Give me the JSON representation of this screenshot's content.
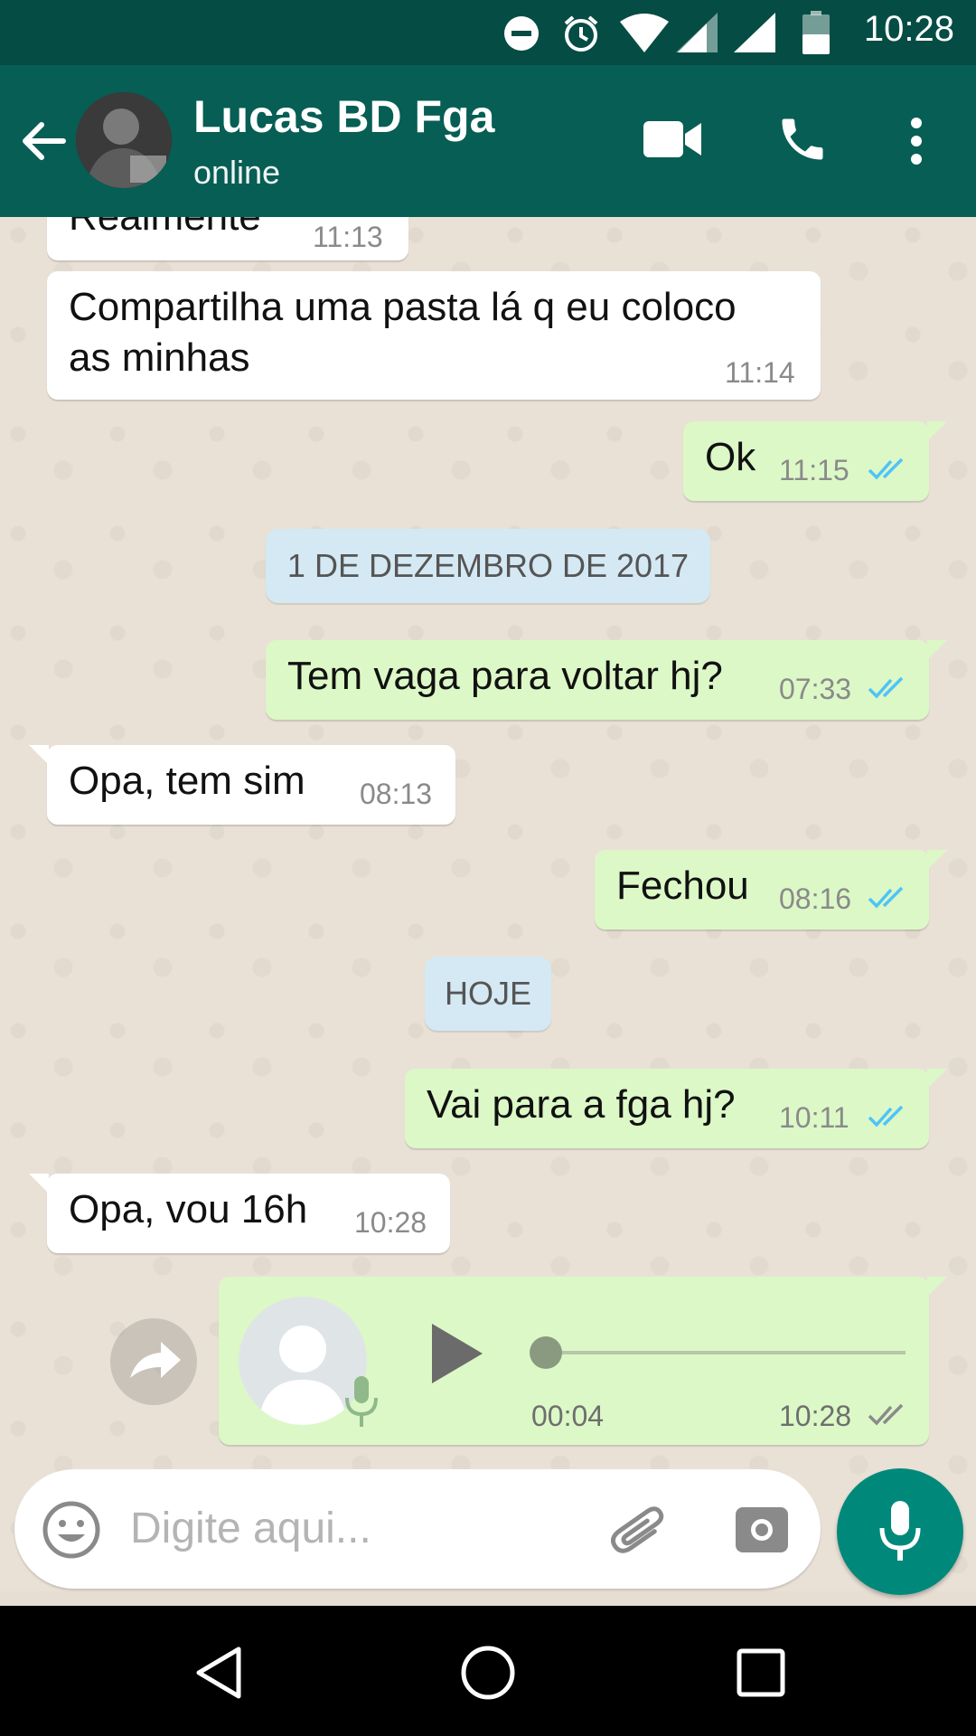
{
  "status_bar": {
    "time": "10:28",
    "icons": [
      "do-not-disturb-icon",
      "alarm-icon",
      "wifi-icon",
      "cell-signal-icon",
      "cell-signal-icon",
      "battery-icon"
    ]
  },
  "header": {
    "contact_name": "Lucas BD Fga",
    "status": "online",
    "icons": [
      "back-arrow-icon",
      "video-call-icon",
      "phone-icon",
      "more-vert-icon"
    ]
  },
  "messages": [
    {
      "direction": "in",
      "text": "Realmente",
      "time": "11:13"
    },
    {
      "direction": "in",
      "text_lines": [
        "Compartilha uma pasta lá q eu coloco",
        "as minhas"
      ],
      "time": "11:14"
    },
    {
      "direction": "out",
      "text": "Ok",
      "time": "11:15",
      "status": "read"
    },
    {
      "type": "date",
      "text": "1 DE DEZEMBRO DE 2017"
    },
    {
      "direction": "out",
      "text": "Tem vaga para voltar hj?",
      "time": "07:33",
      "status": "read"
    },
    {
      "direction": "in",
      "text": "Opa, tem sim",
      "time": "08:13"
    },
    {
      "direction": "out",
      "text": "Fechou",
      "time": "08:16",
      "status": "read"
    },
    {
      "type": "date",
      "text": "HOJE"
    },
    {
      "direction": "out",
      "text": "Vai para a fga hj?",
      "time": "10:11",
      "status": "read"
    },
    {
      "direction": "in",
      "text": "Opa, vou 16h",
      "time": "10:28"
    },
    {
      "direction": "out",
      "type": "voice",
      "duration": "00:04",
      "time": "10:28",
      "status": "delivered",
      "progress": 0
    }
  ],
  "composer": {
    "placeholder": "Digite aqui...",
    "icons": [
      "emoji-icon",
      "attach-icon",
      "camera-icon",
      "mic-icon"
    ]
  },
  "colors": {
    "status_bar": "#054d44",
    "header": "#075e54",
    "outgoing_bubble": "#dcf8c6",
    "incoming_bubble": "#ffffff",
    "date_pill": "#d4e9f3",
    "fab": "#00897b",
    "read_ticks": "#4fc3f7"
  }
}
